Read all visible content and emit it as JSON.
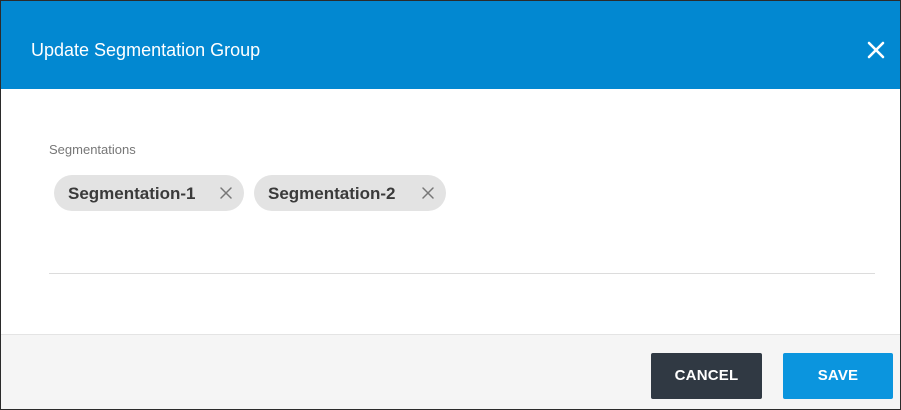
{
  "dialog": {
    "title": "Update Segmentation Group",
    "close_icon": "close-icon"
  },
  "segmentations": {
    "label": "Segmentations",
    "chips": [
      {
        "label": "Segmentation-1",
        "remove_icon": "close-icon"
      },
      {
        "label": "Segmentation-2",
        "remove_icon": "close-icon"
      }
    ]
  },
  "footer": {
    "cancel_label": "CANCEL",
    "save_label": "SAVE"
  },
  "colors": {
    "header_bg": "#0288d1",
    "cancel_bg": "#303943",
    "save_bg": "#0b95de"
  }
}
